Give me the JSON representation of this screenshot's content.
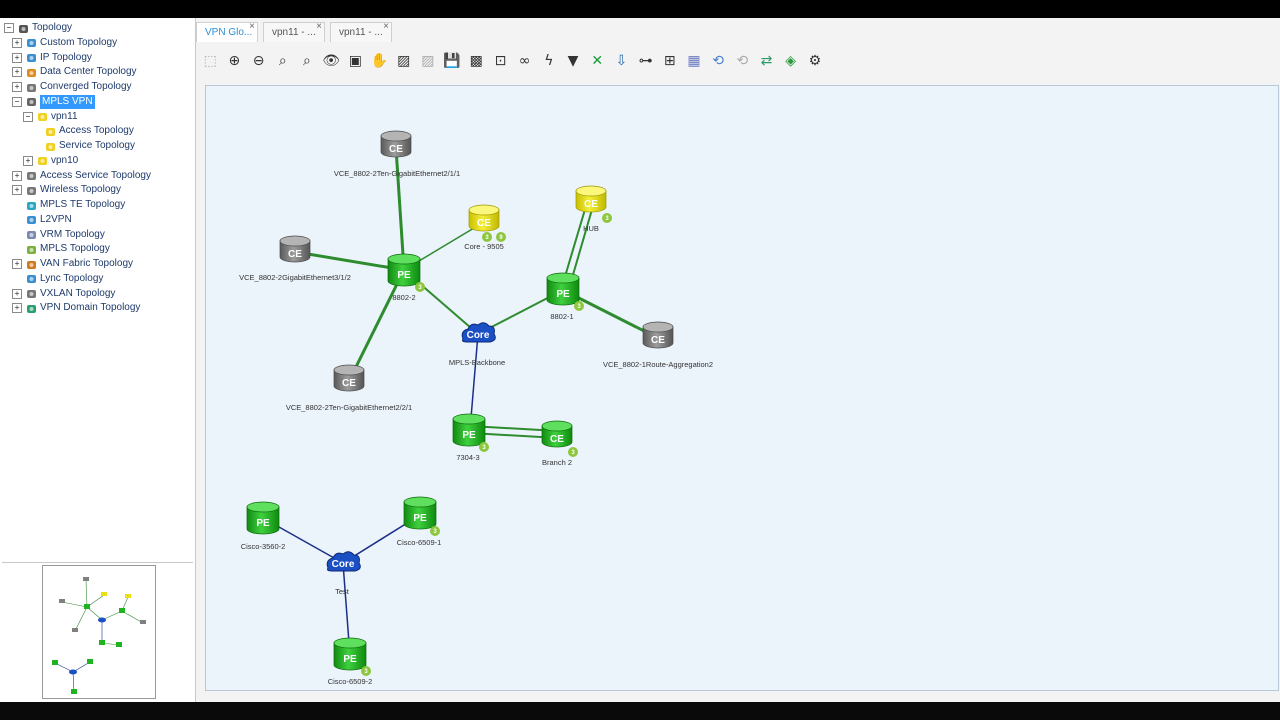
{
  "sidebar": {
    "items": [
      {
        "label": "Topology",
        "level": 0,
        "expander": "−",
        "icon": "topology-root-icon"
      },
      {
        "label": "Custom Topology",
        "level": 1,
        "expander": "+",
        "icon": "custom-topology-icon"
      },
      {
        "label": "IP Topology",
        "level": 1,
        "expander": "+",
        "icon": "ip-topology-icon"
      },
      {
        "label": "Data Center Topology",
        "level": 1,
        "expander": "+",
        "icon": "data-center-icon"
      },
      {
        "label": "Converged Topology",
        "level": 1,
        "expander": "+",
        "icon": "converged-icon"
      },
      {
        "label": "MPLS VPN",
        "level": 1,
        "expander": "−",
        "icon": "mpls-vpn-icon",
        "selected": true
      },
      {
        "label": "vpn11",
        "level": 2,
        "expander": "−",
        "icon": "vpn-folder-icon"
      },
      {
        "label": "Access Topology",
        "level": 3,
        "expander": "",
        "icon": "access-topology-icon"
      },
      {
        "label": "Service Topology",
        "level": 3,
        "expander": "",
        "icon": "service-topology-icon"
      },
      {
        "label": "vpn10",
        "level": 2,
        "expander": "+",
        "icon": "vpn-folder-icon"
      },
      {
        "label": "Access Service Topology",
        "level": 1,
        "expander": "+",
        "icon": "access-service-icon"
      },
      {
        "label": "Wireless Topology",
        "level": 1,
        "expander": "+",
        "icon": "wireless-icon"
      },
      {
        "label": "MPLS TE Topology",
        "level": 1,
        "expander": "",
        "icon": "mpls-te-icon"
      },
      {
        "label": "L2VPN",
        "level": 1,
        "expander": "",
        "icon": "l2vpn-icon"
      },
      {
        "label": "VRM Topology",
        "level": 1,
        "expander": "",
        "icon": "vrm-icon"
      },
      {
        "label": "MPLS Topology",
        "level": 1,
        "expander": "",
        "icon": "mpls-icon"
      },
      {
        "label": "VAN Fabric Topology",
        "level": 1,
        "expander": "+",
        "icon": "van-fabric-icon"
      },
      {
        "label": "Lync Topology",
        "level": 1,
        "expander": "",
        "icon": "lync-icon"
      },
      {
        "label": "VXLAN Topology",
        "level": 1,
        "expander": "+",
        "icon": "vxlan-icon"
      },
      {
        "label": "VPN Domain Topology",
        "level": 1,
        "expander": "+",
        "icon": "vpn-domain-icon"
      }
    ]
  },
  "tabs": [
    {
      "label": "VPN Glo...",
      "active": true,
      "close": "×"
    },
    {
      "label": "vpn11 - ...",
      "active": false,
      "close": "×"
    },
    {
      "label": "vpn11 - ...",
      "active": false,
      "close": "×"
    }
  ],
  "toolbar": {
    "icons": [
      "select-icon",
      "zoom-in-icon",
      "zoom-out-icon",
      "zoom-region-icon",
      "zoom-fit-icon",
      "view-icon",
      "fit-window-icon",
      "pan-hand-icon",
      "image-edit-icon",
      "image-disabled-icon",
      "save-icon",
      "export-image-icon",
      "layout-icon",
      "find-binoculars-icon",
      "lightning-icon",
      "filter-icon",
      "link-tools-icon",
      "import-icon",
      "tree-layout-icon",
      "hierarchy-icon",
      "grid-layout-icon",
      "refresh-icon",
      "refresh-disabled-icon",
      "sync-icon",
      "network-icon",
      "settings-gears-icon"
    ]
  },
  "topology": {
    "colors": {
      "pe": "#1fb41f",
      "ce_gray": "#7a7a7a",
      "ce_yellow": "#e8e010",
      "core": "#1b4fc4",
      "link_green": "#2e8b2e",
      "link_blue": "#1a2f8a",
      "badge": "#8dc63f",
      "canvas": "#ebf3fb"
    },
    "nodes": [
      {
        "id": "ce1",
        "type": "CE",
        "color": "gray",
        "text": "CE",
        "label": "VCE_8802-2Ten-GigabitEthernet2/1/1"
      },
      {
        "id": "ce2",
        "type": "CE",
        "color": "yellow",
        "text": "CE",
        "label": "Core - 9505",
        "badges": [
          "3",
          "9"
        ]
      },
      {
        "id": "ce3",
        "type": "CE",
        "color": "yellow",
        "text": "CE",
        "label": "HUB",
        "badges": [
          "3"
        ]
      },
      {
        "id": "ce4",
        "type": "CE",
        "color": "gray",
        "text": "CE",
        "label": "VCE_8802-2GigabitEthernet3/1/2"
      },
      {
        "id": "pe1",
        "type": "PE",
        "text": "PE",
        "label": "8802-2",
        "badges": [
          "3"
        ]
      },
      {
        "id": "pe2",
        "type": "PE",
        "text": "PE",
        "label": "8802-1",
        "badges": [
          "3"
        ]
      },
      {
        "id": "core1",
        "type": "Core",
        "text": "Core",
        "label": "MPLS-Backbone"
      },
      {
        "id": "ce5",
        "type": "CE",
        "color": "gray",
        "text": "CE",
        "label": "VCE_8802-1Route-Aggregation2"
      },
      {
        "id": "ce6",
        "type": "CE",
        "color": "gray",
        "text": "CE",
        "label": "VCE_8802-2Ten-GigabitEthernet2/2/1"
      },
      {
        "id": "pe3",
        "type": "PE",
        "text": "PE",
        "label": "7304-3",
        "badges": [
          "3"
        ]
      },
      {
        "id": "ce7",
        "type": "CE",
        "color": "green",
        "text": "CE",
        "label": "Branch 2",
        "badges": [
          "3"
        ]
      },
      {
        "id": "pe4",
        "type": "PE",
        "text": "PE",
        "label": "Cisco-3560-2"
      },
      {
        "id": "pe5",
        "type": "PE",
        "text": "PE",
        "label": "Cisco-6509-1",
        "badges": [
          "3"
        ]
      },
      {
        "id": "core2",
        "type": "Core",
        "text": "Core",
        "label": "Test"
      },
      {
        "id": "pe6",
        "type": "PE",
        "text": "PE",
        "label": "Cisco-6509-2",
        "badges": [
          "3"
        ]
      }
    ]
  }
}
